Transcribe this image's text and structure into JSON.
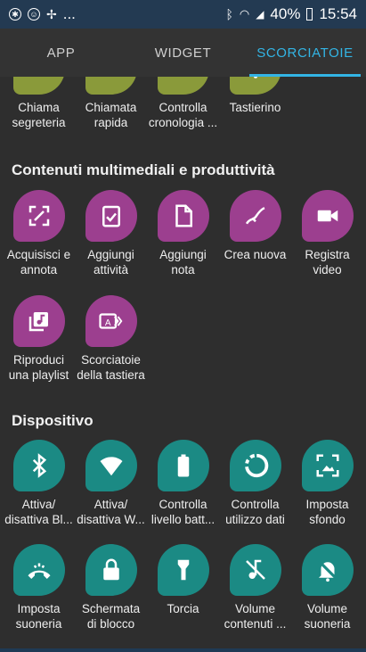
{
  "status": {
    "battery": "40%",
    "time": "15:54",
    "dots": "..."
  },
  "tabs": [
    "APP",
    "WIDGET",
    "SCORCIATOIE"
  ],
  "row0": [
    {
      "l1": "Chiama",
      "l2": "segreteria"
    },
    {
      "l1": "Chiamata",
      "l2": "rapida"
    },
    {
      "l1": "Controlla",
      "l2": "cronologia ..."
    },
    {
      "l1": "Tastierino",
      "l2": ""
    }
  ],
  "sections": {
    "media": "Contenuti multimediali e produttività",
    "device": "Dispositivo"
  },
  "media": [
    {
      "l1": "Acquisisci e",
      "l2": "annota"
    },
    {
      "l1": "Aggiungi",
      "l2": "attività"
    },
    {
      "l1": "Aggiungi",
      "l2": "nota"
    },
    {
      "l1": "Crea nuova",
      "l2": ""
    },
    {
      "l1": "Registra",
      "l2": "video"
    },
    {
      "l1": "Riproduci",
      "l2": "una playlist"
    },
    {
      "l1": "Scorciatoie",
      "l2": "della tastiera"
    }
  ],
  "device": [
    {
      "l1": "Attiva/",
      "l2": "disattiva Bl..."
    },
    {
      "l1": "Attiva/",
      "l2": "disattiva W..."
    },
    {
      "l1": "Controlla",
      "l2": "livello batt..."
    },
    {
      "l1": "Controlla",
      "l2": "utilizzo dati"
    },
    {
      "l1": "Imposta",
      "l2": "sfondo"
    },
    {
      "l1": "Imposta",
      "l2": "suoneria"
    },
    {
      "l1": "Schermata",
      "l2": "di blocco"
    },
    {
      "l1": "Torcia",
      "l2": ""
    },
    {
      "l1": "Volume",
      "l2": "contenuti ..."
    },
    {
      "l1": "Volume",
      "l2": "suoneria"
    }
  ],
  "colors": {
    "accent": "#33b5e5",
    "green": "#8a9a3a",
    "purple": "#9c3f8f",
    "teal": "#1b8a84"
  }
}
